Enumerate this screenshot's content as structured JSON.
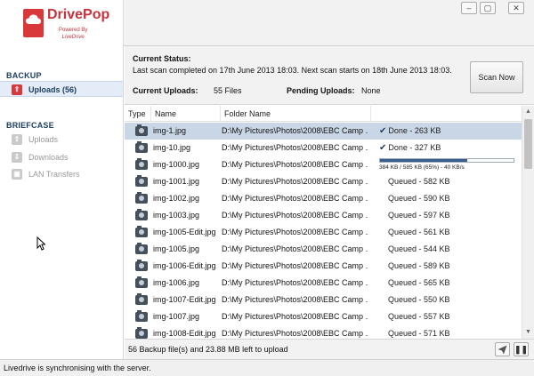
{
  "app": {
    "name": "DrivePop",
    "powered_by": "Powered By",
    "powered_brand": "LiveDrive",
    "window_controls": [
      "minimize",
      "maximize",
      "close"
    ]
  },
  "sidebar": {
    "backup_title": "BACKUP",
    "backup_items": [
      {
        "label": "Uploads (56)",
        "icon": "upload-arrow-icon",
        "active": true
      }
    ],
    "briefcase_title": "BRIEFCASE",
    "briefcase_items": [
      {
        "label": "Uploads",
        "icon": "upload-arrow-icon"
      },
      {
        "label": "Downloads",
        "icon": "download-arrow-icon"
      },
      {
        "label": "LAN Transfers",
        "icon": "lan-icon"
      }
    ]
  },
  "status": {
    "title": "Current Status:",
    "text": "Last scan completed on 17th June 2013 18:03. Next scan starts on 18th June 2013 18:03.",
    "current_label": "Current Uploads:",
    "current_value": "55 Files",
    "pending_label": "Pending Uploads:",
    "pending_value": "None",
    "scan_button": "Scan Now"
  },
  "table": {
    "columns": [
      "Type",
      "Name",
      "Folder Name",
      ""
    ],
    "rows": [
      {
        "name": "img-1.jpg",
        "folder": "D:\\My Pictures\\Photos\\2008\\EBC Camp ...",
        "status": "Done - 263 KB",
        "done": true,
        "selected": true
      },
      {
        "name": "img-10.jpg",
        "folder": "D:\\My Pictures\\Photos\\2008\\EBC Camp ...",
        "status": "Done - 327 KB",
        "done": true
      },
      {
        "name": "img-1000.jpg",
        "folder": "D:\\My Pictures\\Photos\\2008\\EBC Camp ...",
        "status": "384 KB / 585 KB (65%) - 40 KB/s",
        "progress": 0.65
      },
      {
        "name": "img-1001.jpg",
        "folder": "D:\\My Pictures\\Photos\\2008\\EBC Camp ...",
        "status": "Queued - 582 KB"
      },
      {
        "name": "img-1002.jpg",
        "folder": "D:\\My Pictures\\Photos\\2008\\EBC Camp ...",
        "status": "Queued - 590 KB"
      },
      {
        "name": "img-1003.jpg",
        "folder": "D:\\My Pictures\\Photos\\2008\\EBC Camp ...",
        "status": "Queued - 597 KB"
      },
      {
        "name": "img-1005-Edit.jpg",
        "folder": "D:\\My Pictures\\Photos\\2008\\EBC Camp ...",
        "status": "Queued - 561 KB"
      },
      {
        "name": "img-1005.jpg",
        "folder": "D:\\My Pictures\\Photos\\2008\\EBC Camp ...",
        "status": "Queued - 544 KB"
      },
      {
        "name": "img-1006-Edit.jpg",
        "folder": "D:\\My Pictures\\Photos\\2008\\EBC Camp ...",
        "status": "Queued - 589 KB"
      },
      {
        "name": "img-1006.jpg",
        "folder": "D:\\My Pictures\\Photos\\2008\\EBC Camp ...",
        "status": "Queued - 565 KB"
      },
      {
        "name": "img-1007-Edit.jpg",
        "folder": "D:\\My Pictures\\Photos\\2008\\EBC Camp ...",
        "status": "Queued - 550 KB"
      },
      {
        "name": "img-1007.jpg",
        "folder": "D:\\My Pictures\\Photos\\2008\\EBC Camp ...",
        "status": "Queued - 557 KB"
      },
      {
        "name": "img-1008-Edit.jpg",
        "folder": "D:\\My Pictures\\Photos\\2008\\EBC Camp ...",
        "status": "Queued - 571 KB"
      }
    ]
  },
  "footer": {
    "text": "56 Backup file(s) and 23.88 MB left to upload",
    "send_icon": "paper-plane-icon",
    "pause_icon": "pause-icon"
  },
  "statusbar": {
    "text": "Livedrive is synchronising with the server."
  }
}
